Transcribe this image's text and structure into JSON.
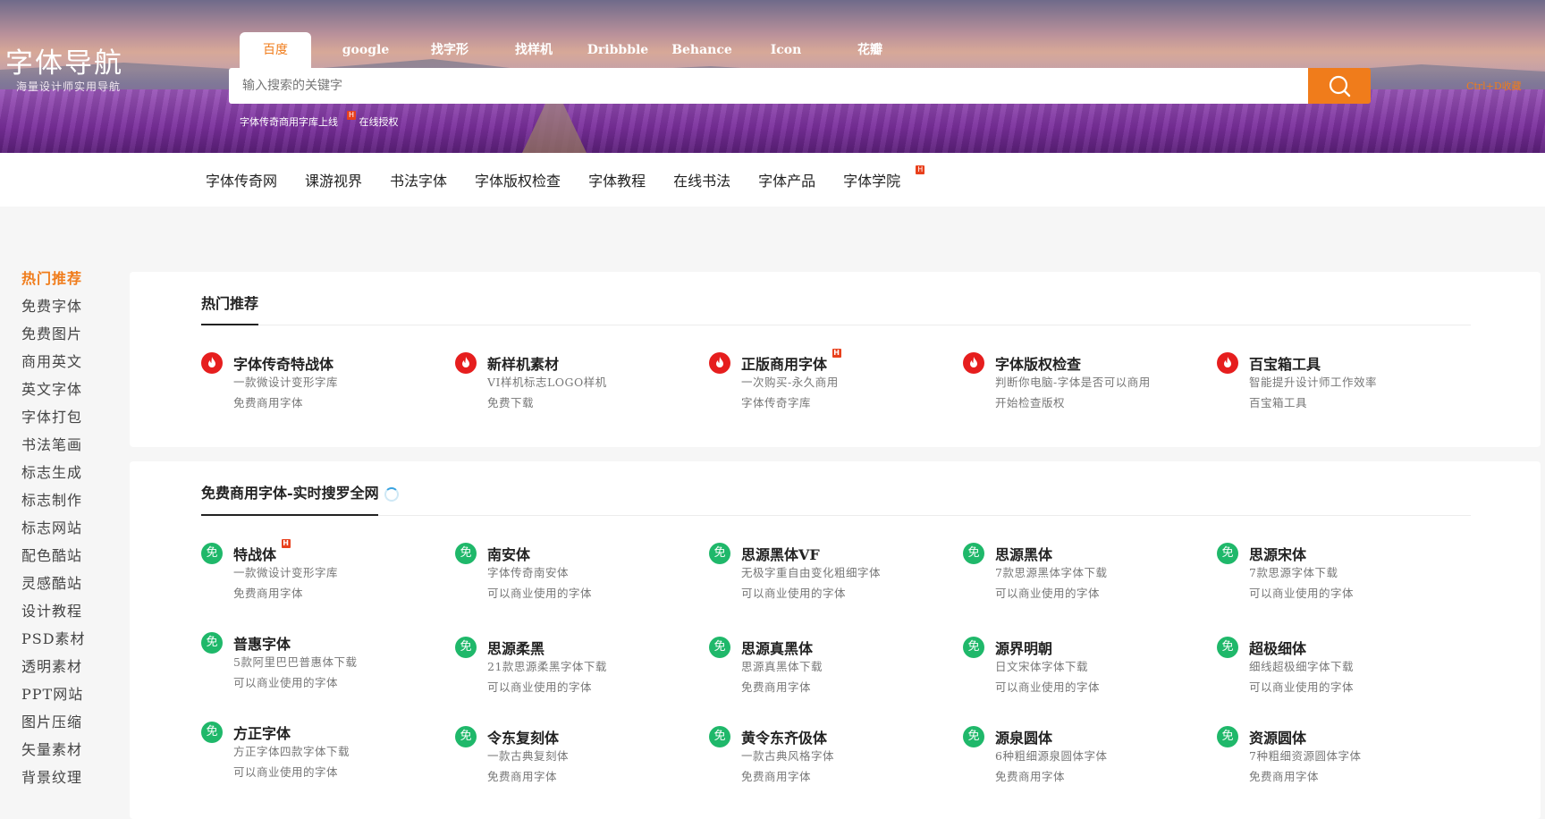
{
  "logo": {
    "title": "字体导航",
    "subtitle": "海量设计师实用导航"
  },
  "search_tabs": [
    "百度",
    "google",
    "找字形",
    "找样机",
    "Dribbble",
    "Behance",
    "Icon",
    "花瓣"
  ],
  "search": {
    "placeholder": "输入搜索的关键字"
  },
  "hot_links": [
    "字体传奇商用字库上线",
    "在线授权"
  ],
  "shortcut": "Ctrl+D收藏",
  "badge": "H",
  "nav": [
    "字体传奇网",
    "课游视界",
    "书法字体",
    "字体版权检查",
    "字体教程",
    "在线书法",
    "字体产品",
    "字体学院"
  ],
  "sidebar": [
    "热门推荐",
    "免费字体",
    "免费图片",
    "商用英文",
    "英文字体",
    "字体打包",
    "书法笔画",
    "标志生成",
    "标志制作",
    "标志网站",
    "配色酷站",
    "灵感酷站",
    "设计教程",
    "PSD素材",
    "透明素材",
    "PPT网站",
    "图片压缩",
    "矢量素材",
    "背景纹理"
  ],
  "free_icon_text": "免",
  "hot": {
    "title": "热门推荐",
    "items": [
      {
        "name": "字体传奇特战体",
        "d1": "一款微设计变形字库",
        "d2": "免费商用字体"
      },
      {
        "name": "新样机素材",
        "d1": "VI样机标志LOGO样机",
        "d2": "免费下载"
      },
      {
        "name": "正版商用字体",
        "d1": "一次购买-永久商用",
        "d2": "字体传奇字库"
      },
      {
        "name": "字体版权检查",
        "d1": "判断你电脑-字体是否可以商用",
        "d2": "开始检查版权"
      },
      {
        "name": "百宝箱工具",
        "d1": "智能提升设计师工作效率",
        "d2": "百宝箱工具"
      }
    ]
  },
  "free": {
    "title": "免费商用字体-实时搜罗全网",
    "rows": [
      [
        {
          "name": "特战体",
          "d1": "一款微设计变形字库",
          "d2": "免费商用字体"
        },
        {
          "name": "南安体",
          "d1": "字体传奇南安体",
          "d2": "可以商业使用的字体"
        },
        {
          "name": "思源黑体VF",
          "d1": "无极字重自由变化粗细字体",
          "d2": "可以商业使用的字体"
        },
        {
          "name": "思源黑体",
          "d1": "7款思源黑体字体下载",
          "d2": "可以商业使用的字体"
        },
        {
          "name": "思源宋体",
          "d1": "7款思源字体下载",
          "d2": "可以商业使用的字体"
        }
      ],
      [
        {
          "name": "普惠字体",
          "d1": "5款阿里巴巴普惠体下载",
          "d2": "可以商业使用的字体"
        },
        {
          "name": "思源柔黑",
          "d1": "21款思源柔黑字体下载",
          "d2": "可以商业使用的字体"
        },
        {
          "name": "思源真黑体",
          "d1": "思源真黑体下载",
          "d2": "免费商用字体"
        },
        {
          "name": "源界明朝",
          "d1": "日文宋体字体下载",
          "d2": "可以商业使用的字体"
        },
        {
          "name": "超极细体",
          "d1": "细线超极细字体下载",
          "d2": "可以商业使用的字体"
        }
      ],
      [
        {
          "name": "方正字体",
          "d1": "方正字体四款字体下载",
          "d2": "可以商业使用的字体"
        },
        {
          "name": "令东复刻体",
          "d1": "一款古典复刻体",
          "d2": "免费商用字体"
        },
        {
          "name": "黄令东齐伋体",
          "d1": "一款古典风格字体",
          "d2": "免费商用字体"
        },
        {
          "name": "源泉圆体",
          "d1": "6种粗细源泉圆体字体",
          "d2": "免费商用字体"
        },
        {
          "name": "资源圆体",
          "d1": "7种粗细资源圆体字体",
          "d2": "免费商用字体"
        }
      ]
    ]
  },
  "colors": {
    "accent": "#f07c1b",
    "hot_icon": "#e61e1e",
    "free_icon": "#1fb86a",
    "badge": "#e8401c"
  }
}
